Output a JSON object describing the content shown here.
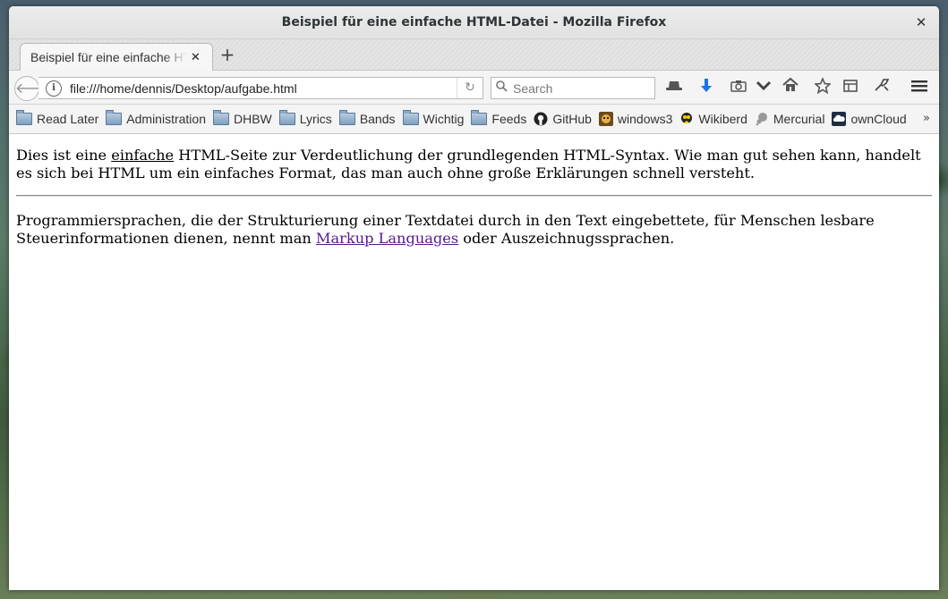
{
  "window": {
    "title": "Beispiel für eine einfache HTML-Datei - Mozilla Firefox"
  },
  "tab": {
    "label": "Beispiel für eine einfache HTML",
    "close": "✕"
  },
  "newtab": "+",
  "nav": {
    "url": "file:///home/dennis/Desktop/aufgabe.html",
    "search_placeholder": "Search"
  },
  "bookmarks": [
    {
      "label": "Read Later",
      "icon": "folder-icon"
    },
    {
      "label": "Administration",
      "icon": "folder-icon"
    },
    {
      "label": "DHBW",
      "icon": "folder-icon"
    },
    {
      "label": "Lyrics",
      "icon": "folder-icon"
    },
    {
      "label": "Bands",
      "icon": "folder-icon"
    },
    {
      "label": "Wichtig",
      "icon": "folder-icon"
    },
    {
      "label": "Feeds",
      "icon": "folder-icon"
    },
    {
      "label": "GitHub",
      "icon": "github-icon"
    },
    {
      "label": "windows3",
      "icon": "windows3-favicon"
    },
    {
      "label": "Wikiberd",
      "icon": "wikiberd-favicon"
    },
    {
      "label": "Mercurial",
      "icon": "mercurial-favicon"
    },
    {
      "label": "ownCloud",
      "icon": "owncloud-favicon"
    }
  ],
  "content": {
    "p1_before": "Dies ist eine ",
    "p1_underlined": "einfache",
    "p1_after": " HTML-Seite zur Verdeutlichung der grundlegenden HTML-Syntax. Wie man gut sehen kann, handelt es sich bei HTML um ein einfaches Format, das man auch ohne große Erklärungen schnell versteht.",
    "p2_before": "Programmiersprachen, die der Strukturierung einer Textdatei durch in den Text eingebettete, für Menschen lesbare Steuerinformationen dienen, nennt man ",
    "p2_link": "Markup Languages",
    "p2_after": " oder Auszeichnugssprachen."
  },
  "colors": {
    "link_visited": "#551a8b",
    "download_arrow": "#1a73e8"
  }
}
